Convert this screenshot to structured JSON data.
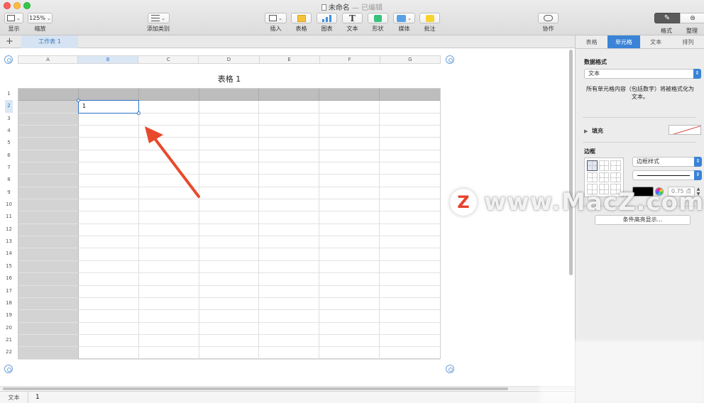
{
  "window": {
    "title": "未命名",
    "title_separator": " — ",
    "title_state": "已编辑"
  },
  "toolbar": {
    "view_label": "显示",
    "zoom_value": "125%",
    "zoom_label": "缩放",
    "add_category_label": "添加类别",
    "insert_label": "插入",
    "table_label": "表格",
    "chart_label": "图表",
    "text_label": "文本",
    "shape_label": "形状",
    "media_label": "媒体",
    "comment_label": "批注",
    "collaborate_label": "协作",
    "format_label": "格式",
    "organize_label": "整理"
  },
  "sheets": {
    "add_symbol": "+",
    "tabs": [
      "工作表 1"
    ]
  },
  "table": {
    "title": "表格 1",
    "columns": [
      "A",
      "B",
      "C",
      "D",
      "E",
      "F",
      "G"
    ],
    "rows": [
      "1",
      "2",
      "3",
      "4",
      "5",
      "6",
      "7",
      "8",
      "9",
      "10",
      "11",
      "12",
      "13",
      "14",
      "15",
      "16",
      "17",
      "18",
      "19",
      "20",
      "21",
      "22"
    ],
    "selected_column": "B",
    "selected_row": "2",
    "cells": {
      "B2": "1"
    }
  },
  "formula_bar": {
    "type": "文本",
    "value": "1"
  },
  "inspector": {
    "tabs": [
      "表格",
      "单元格",
      "文本",
      "排列"
    ],
    "active_tab": "单元格",
    "data_format_title": "数据格式",
    "data_format_value": "文本",
    "data_format_note": "所有单元格内容（包括数字）将被格式化为文本。",
    "fill_label": "填充",
    "border_title": "边框",
    "border_style_value": "边框样式",
    "border_width_value": "0.75 点",
    "conditional_button": "条件高亮显示..."
  },
  "watermark": {
    "logo_letter": "Z",
    "text": "www.MacZ.com"
  },
  "colors": {
    "accent": "#3a83d6",
    "arrow": "#e8492c",
    "header_row": "#bdbdbd",
    "header_col": "#d3d3d3"
  }
}
